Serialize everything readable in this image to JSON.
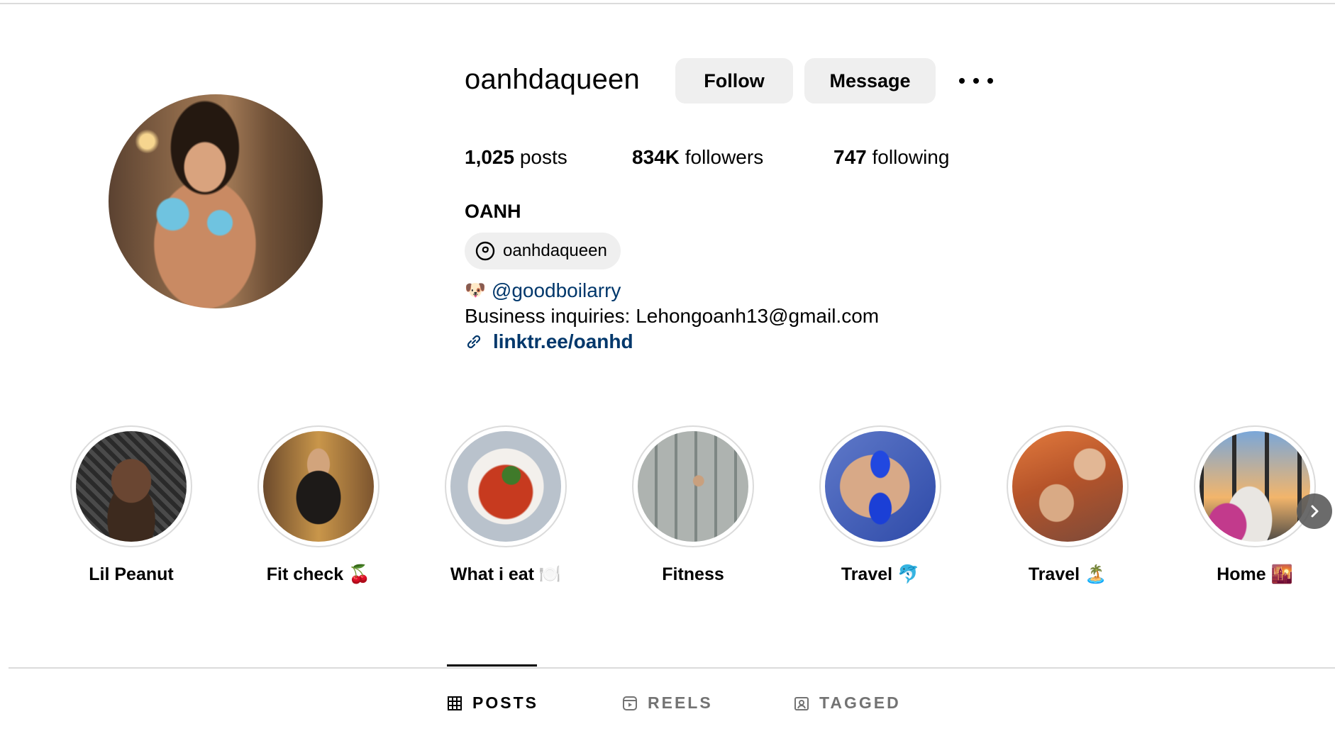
{
  "profile": {
    "username": "oanhdaqueen",
    "full_name": "OANH",
    "threads_handle": "oanhdaqueen",
    "follow_label": "Follow",
    "message_label": "Message"
  },
  "stats": {
    "posts_count": "1,025",
    "posts_label": "posts",
    "followers_count": "834K",
    "followers_label": "followers",
    "following_count": "747",
    "following_label": "following"
  },
  "bio": {
    "line1_emoji": "🐶",
    "mention": "@goodboilarry",
    "line2": "Business inquiries: Lehongoanh13@gmail.com",
    "link": "linktr.ee/oanhd"
  },
  "highlights": [
    {
      "label": "Lil Peanut"
    },
    {
      "label": "Fit check 🍒"
    },
    {
      "label": "What i eat 🍽️"
    },
    {
      "label": "Fitness"
    },
    {
      "label": "Travel 🐬"
    },
    {
      "label": "Travel 🏝️"
    },
    {
      "label": "Home 🌇"
    }
  ],
  "tabs": {
    "posts": "POSTS",
    "reels": "REELS",
    "tagged": "TAGGED"
  },
  "icons": {
    "more": "more-options-icon",
    "threads": "threads-icon",
    "link": "link-icon",
    "grid": "grid-icon",
    "reels": "reels-icon",
    "tagged": "tagged-icon",
    "next": "chevron-right-icon"
  }
}
